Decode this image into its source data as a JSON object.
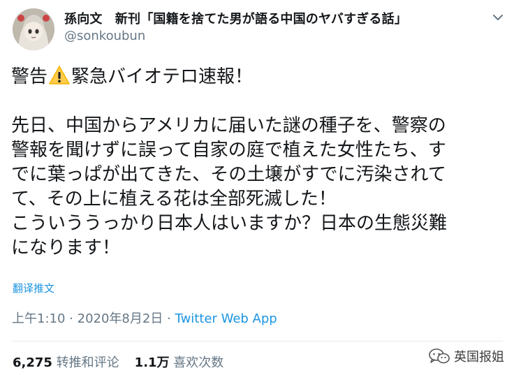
{
  "author": {
    "display_name": "孫向文　新刊「国籍を捨てた男が語る中国のヤバすぎる話」",
    "handle": "@sonkoubun",
    "avatar_icon": "avatar-anime-girl"
  },
  "tweet": {
    "line1_before": "警告",
    "line1_icon": "warning-icon",
    "line1_after": "緊急バイオテロ速報！",
    "paragraph": "先日、中国からアメリカに届いた謎の種子を、警察の\n警報を聞けずに誤って自家の庭で植えた女性たち、す\nでに葉っぱが出てきた、その土壌がすでに汚染されて\nて、その上に植える花は全部死滅した！\nこういううっかり日本人はいますか？日本の生態災難\nになります！"
  },
  "translate_label": "翻译推文",
  "meta": {
    "time": "上午1:10",
    "date": "2020年8月2日",
    "separator": "·",
    "source": "Twitter Web App"
  },
  "stats": {
    "retweets_count": "6,275",
    "retweets_label": "转推和评论",
    "likes_count": "1.1万",
    "likes_label": "喜欢次数"
  },
  "watermark": {
    "text": "英国报姐",
    "icon": "wechat-icon"
  },
  "colors": {
    "link": "#1b95e0",
    "secondary": "#657786",
    "text": "#14171a",
    "warning": "#ffcc4d"
  }
}
